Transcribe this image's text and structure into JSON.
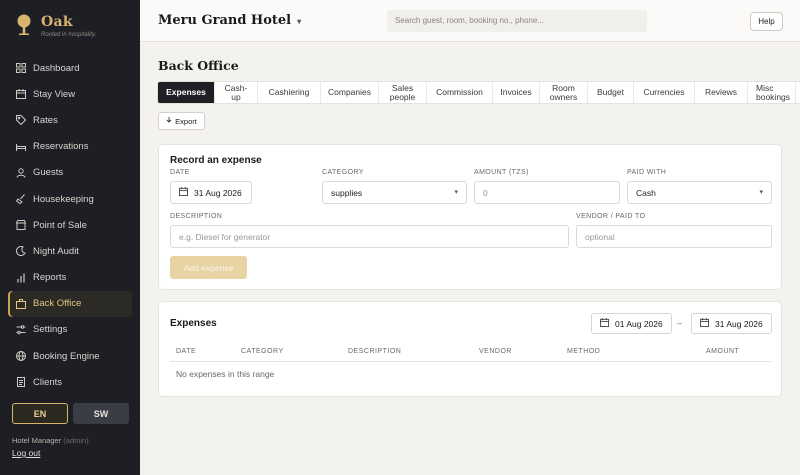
{
  "brand": {
    "name": "Oak",
    "tagline": "Rooted in hospitality."
  },
  "nav": [
    {
      "label": "Dashboard",
      "icon": "grid-icon"
    },
    {
      "label": "Stay View",
      "icon": "calendar-icon"
    },
    {
      "label": "Rates",
      "icon": "tag-icon"
    },
    {
      "label": "Reservations",
      "icon": "bed-icon"
    },
    {
      "label": "Guests",
      "icon": "user-icon"
    },
    {
      "label": "Housekeeping",
      "icon": "broom-icon"
    },
    {
      "label": "Point of Sale",
      "icon": "store-icon"
    },
    {
      "label": "Night Audit",
      "icon": "moon-icon"
    },
    {
      "label": "Reports",
      "icon": "bar-chart-icon"
    },
    {
      "label": "Back Office",
      "icon": "briefcase-icon",
      "active": true
    },
    {
      "label": "Settings",
      "icon": "sliders-icon"
    },
    {
      "label": "Booking Engine",
      "icon": "globe-icon"
    },
    {
      "label": "Clients",
      "icon": "document-icon"
    }
  ],
  "lang": {
    "en": "EN",
    "sw": "SW"
  },
  "user": {
    "name": "Hotel Manager",
    "role": "(admin)",
    "logout": "Log out"
  },
  "header": {
    "hotel": "Meru Grand Hotel",
    "caret": "▾",
    "search_placeholder": "Search guest, room, booking no., phone...",
    "help": "Help"
  },
  "page": {
    "title": "Back Office"
  },
  "tabs": [
    {
      "label": "Expenses",
      "active": true
    },
    {
      "label": "Cash-up"
    },
    {
      "label": "Cashiering"
    },
    {
      "label": "Companies"
    },
    {
      "label": "Sales people"
    },
    {
      "label": "Commission"
    },
    {
      "label": "Invoices"
    },
    {
      "label": "Room owners"
    },
    {
      "label": "Budget"
    },
    {
      "label": "Currencies"
    },
    {
      "label": "Reviews"
    },
    {
      "label": "Misc bookings"
    }
  ],
  "export": {
    "label": "Export",
    "icon": "download-icon"
  },
  "expense_form": {
    "title": "Record an expense",
    "date_label": "DATE",
    "date_value": "31 Aug 2026",
    "category_label": "CATEGORY",
    "category_value": "supplies",
    "amount_label": "AMOUNT (TZS)",
    "amount_placeholder": "0",
    "paid_with_label": "PAID WITH",
    "paid_with_value": "Cash",
    "description_label": "DESCRIPTION",
    "description_placeholder": "e.g. Diesel for generator",
    "vendor_label": "VENDOR / PAID TO",
    "vendor_placeholder": "optional",
    "submit": "Add expense"
  },
  "expenses": {
    "title": "Expenses",
    "from": "01 Aug 2026",
    "to": "31 Aug 2026",
    "separator": "–",
    "columns": [
      "DATE",
      "CATEGORY",
      "DESCRIPTION",
      "VENDOR",
      "METHOD",
      "AMOUNT"
    ],
    "empty": "No expenses in this range"
  },
  "colors": {
    "sidebar": "#1d1f24",
    "accent": "#d7b56d",
    "active_tab": "#1e2025"
  }
}
